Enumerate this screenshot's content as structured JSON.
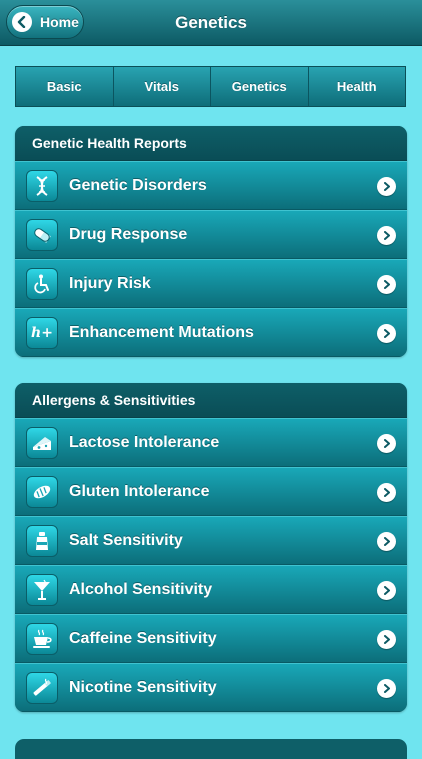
{
  "nav": {
    "title": "Genetics",
    "home_label": "Home"
  },
  "tabs": [
    {
      "label": "Basic"
    },
    {
      "label": "Vitals"
    },
    {
      "label": "Genetics"
    },
    {
      "label": "Health"
    }
  ],
  "sections": [
    {
      "header": "Genetic Health Reports",
      "items": [
        {
          "label": "Genetic Disorders",
          "icon": "dna-icon"
        },
        {
          "label": "Drug Response",
          "icon": "pill-icon"
        },
        {
          "label": "Injury Risk",
          "icon": "wheelchair-icon"
        },
        {
          "label": "Enhancement Mutations",
          "icon": "h-plus-icon",
          "icon_text": "h+"
        }
      ]
    },
    {
      "header": "Allergens & Sensitivities",
      "items": [
        {
          "label": "Lactose Intolerance",
          "icon": "cheese-icon"
        },
        {
          "label": "Gluten Intolerance",
          "icon": "bread-icon"
        },
        {
          "label": "Salt Sensitivity",
          "icon": "salt-shaker-icon"
        },
        {
          "label": "Alcohol Sensitivity",
          "icon": "cocktail-glass-icon"
        },
        {
          "label": "Caffeine Sensitivity",
          "icon": "coffee-cup-icon"
        },
        {
          "label": "Nicotine Sensitivity",
          "icon": "cigarette-icon"
        }
      ]
    }
  ],
  "colors": {
    "background": "#6fe4ef",
    "bar": "#0d5a64",
    "row": "#19a8b8"
  }
}
